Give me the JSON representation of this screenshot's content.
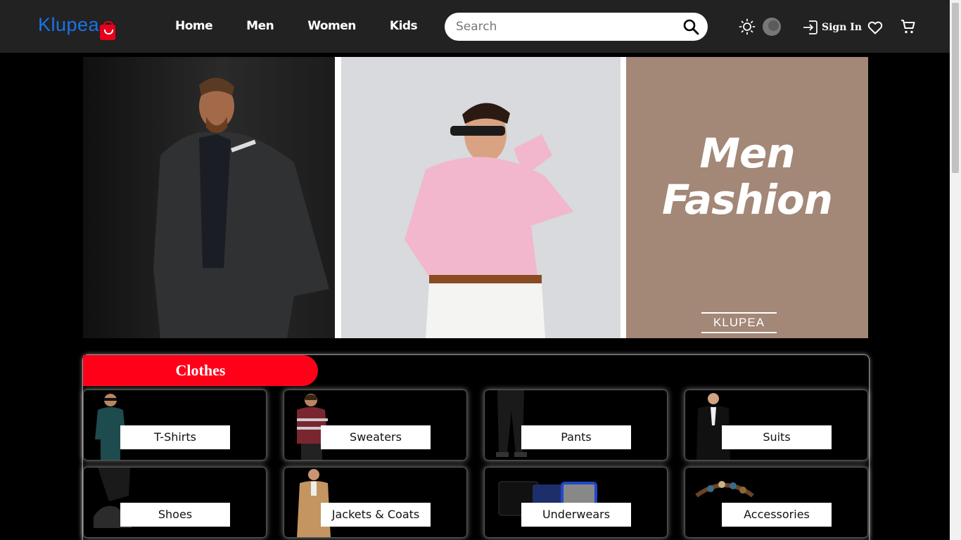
{
  "brand": {
    "name": "Klupea"
  },
  "nav": {
    "items": [
      "Home",
      "Men",
      "Women",
      "Kids"
    ]
  },
  "search": {
    "placeholder": "Search"
  },
  "header": {
    "sign_in": "Sign In"
  },
  "banner": {
    "title_line1": "Men",
    "title_line2": "Fashion",
    "mark": "KLUPEA"
  },
  "section": {
    "title": "Clothes",
    "categories": [
      "T-Shirts",
      "Sweaters",
      "Pants",
      "Suits",
      "Shoes",
      "Jackets & Coats",
      "Underwears",
      "Accessories"
    ]
  },
  "colors": {
    "accent": "#ff0018",
    "logo": "#1a73e8",
    "header_bg": "#222222",
    "banner_panel": "#a38777"
  }
}
